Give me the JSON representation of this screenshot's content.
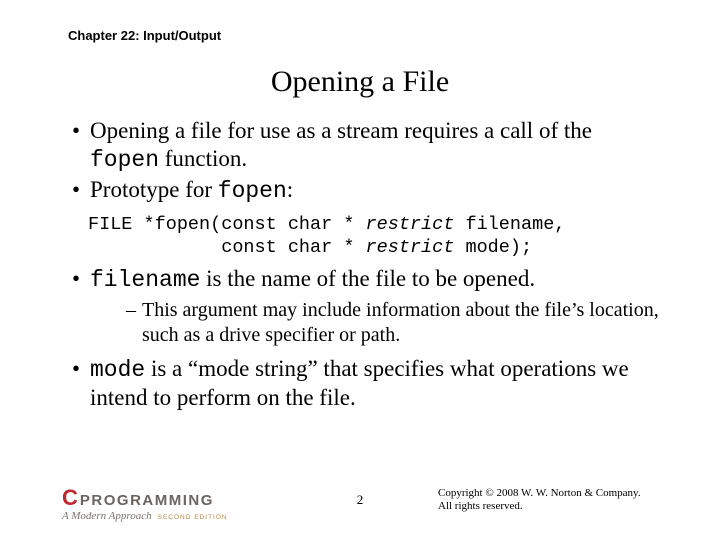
{
  "chapter": "Chapter 22: Input/Output",
  "title": "Opening a File",
  "bullets": {
    "b1a": "Opening a file for use as a stream requires a call of the ",
    "b1b": "fopen",
    "b1c": " function.",
    "b2a": "Prototype for ",
    "b2b": "fopen",
    "b2c": ":",
    "b3a": "filename",
    "b3b": " is the name of the file to be opened.",
    "b4a": "mode",
    "b4b": " is a “mode string” that specifies what operations we intend to perform on the file."
  },
  "code": {
    "l1a": "FILE *fopen(const char * ",
    "l1b": "restrict",
    "l1c": " filename,",
    "l2a": "            const char * ",
    "l2b": "restrict",
    "l2c": " mode);"
  },
  "sub": {
    "s1": "This argument may include information about the file’s location, such as a drive specifier or path."
  },
  "footer": {
    "logo_c": "C",
    "logo_prog": "PROGRAMMING",
    "logo_modern": "A Modern Approach",
    "logo_edition": "SECOND EDITION",
    "page": "2",
    "copy1": "Copyright © 2008 W. W. Norton & Company.",
    "copy2": "All rights reserved."
  }
}
